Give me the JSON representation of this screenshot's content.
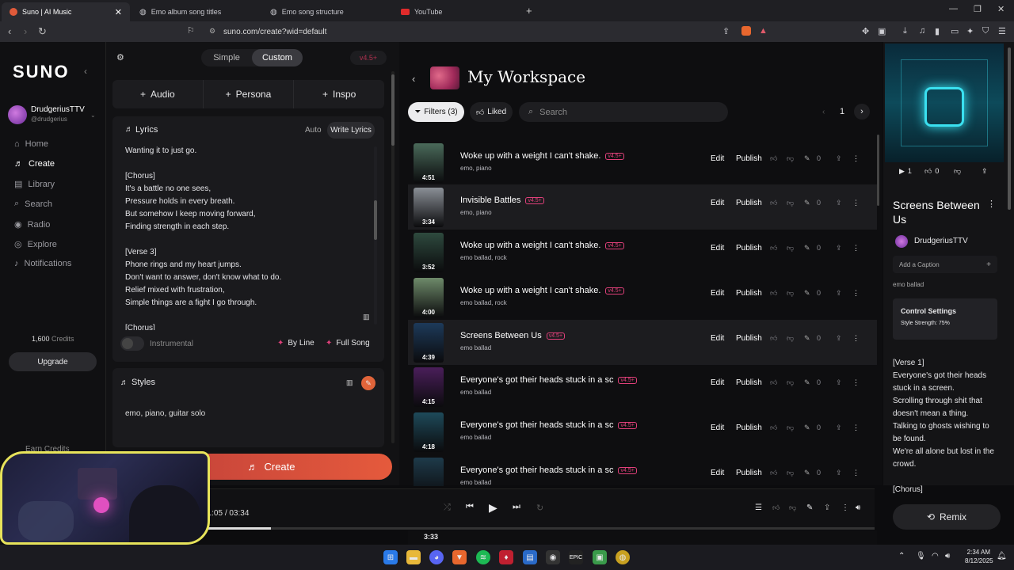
{
  "browser": {
    "tabs": [
      {
        "title": "Suno | AI Music",
        "active": true,
        "color": "#e05a3a"
      },
      {
        "title": "Emo album song titles",
        "active": false,
        "color": "#9a9aa0"
      },
      {
        "title": "Emo song structure",
        "active": false,
        "color": "#9a9aa0"
      },
      {
        "title": "YouTube",
        "active": false,
        "color": "#e02b2b"
      }
    ],
    "url": "suno.com/create?wid=default"
  },
  "sidebar": {
    "logo": "SUNO",
    "user": {
      "name": "DrudgeriusTTV",
      "handle": "@drudgerius"
    },
    "nav": [
      {
        "label": "Home",
        "icon": "home-icon",
        "glyph": "⌂"
      },
      {
        "label": "Create",
        "icon": "create-icon",
        "glyph": "♬",
        "active": true
      },
      {
        "label": "Library",
        "icon": "library-icon",
        "glyph": "▤"
      },
      {
        "label": "Search",
        "icon": "search-icon",
        "glyph": "⌕"
      },
      {
        "label": "Radio",
        "icon": "radio-icon",
        "glyph": "◉"
      },
      {
        "label": "Explore",
        "icon": "explore-icon",
        "glyph": "◎"
      },
      {
        "label": "Notifications",
        "icon": "bell-icon",
        "glyph": "♪"
      }
    ],
    "credits_value": "1,600",
    "credits_label": "Credits",
    "upgrade": "Upgrade",
    "earn_credits": "Earn Credits"
  },
  "create": {
    "mode_simple": "Simple",
    "mode_custom": "Custom",
    "version": "v4.5+",
    "audio": "Audio",
    "persona": "Persona",
    "inspo": "Inspo",
    "lyrics_label": "Lyrics",
    "auto": "Auto",
    "write_lyrics": "Write Lyrics",
    "lyrics_text": "Wanting it to just go.\n\n[Chorus]\nIt's a battle no one sees,\nPressure holds in every breath.\nBut somehow I keep moving forward,\nFinding strength in each step.\n\n[Verse 3]\nPhone rings and my heart jumps.\nDon't want to answer, don't know what to do.\nRelief mixed with frustration,\nSimple things are a fight I go through.\n\n[Chorus]",
    "instrumental": "Instrumental",
    "by_line": "By Line",
    "full_song": "Full Song",
    "styles_label": "Styles",
    "styles_text": "emo, piano, guitar solo",
    "create_button": "Create"
  },
  "workspace": {
    "title": "My Workspace",
    "filters": "Filters (3)",
    "liked": "Liked",
    "search_placeholder": "Search",
    "page": "1",
    "edit": "Edit",
    "publish": "Publish",
    "songs": [
      {
        "title": "Woke up with a weight I can't shake.",
        "version": "v4.5+",
        "tags": "emo, piano",
        "duration": "4:51",
        "likes": "0",
        "thumb": "#4a6a5a"
      },
      {
        "title": "Invisible Battles",
        "version": "v4.5+",
        "tags": "emo, piano",
        "duration": "3:34",
        "likes": "0",
        "thumb": "#8a8f96"
      },
      {
        "title": "Woke up with a weight I can't shake.",
        "version": "v4.5+",
        "tags": "emo ballad, rock",
        "duration": "3:52",
        "likes": "0",
        "thumb": "#2e4a3e"
      },
      {
        "title": "Woke up with a weight I can't shake.",
        "version": "v4.5+",
        "tags": "emo ballad, rock",
        "duration": "4:00",
        "likes": "0",
        "thumb": "#6e8a6a"
      },
      {
        "title": "Screens Between Us",
        "version": "v4.5+",
        "tags": "emo ballad",
        "duration": "4:39",
        "likes": "0",
        "thumb": "#1d3a5a"
      },
      {
        "title": "Everyone's got their heads stuck in a sc",
        "version": "v4.5+",
        "tags": "emo ballad",
        "duration": "4:15",
        "likes": "0",
        "thumb": "#4a1e5a"
      },
      {
        "title": "Everyone's got their heads stuck in a sc",
        "version": "v4.5+",
        "tags": "emo ballad",
        "duration": "4:18",
        "likes": "0",
        "thumb": "#1e4a5a"
      },
      {
        "title": "Everyone's got their heads stuck in a sc",
        "version": "v4.5+",
        "tags": "emo ballad",
        "duration": "",
        "likes": "0",
        "thumb": "#1e3a4a"
      }
    ]
  },
  "detail": {
    "likes": "1",
    "dislikes": "0",
    "title": "Screens Between Us",
    "artist": "DrudgeriusTTV",
    "add_caption": "Add a Caption",
    "tags": "emo ballad",
    "control_title": "Control Settings",
    "style_strength": "Style Strength: 75%",
    "lyrics": "[Verse 1]\nEveryone's got their heads stuck in a screen.\nScrolling through shit that doesn't mean a thing.\nTalking to ghosts wishing to be found.\nWe're all alone but lost in the crowd.\n\n[Chorus]",
    "remix": "Remix"
  },
  "player": {
    "current": "01:05",
    "separator": "/",
    "total": "03:34",
    "progress": 0.31,
    "next_duration": "3:33"
  },
  "taskbar": {
    "time": "2:34 AM",
    "date": "8/12/2025"
  }
}
